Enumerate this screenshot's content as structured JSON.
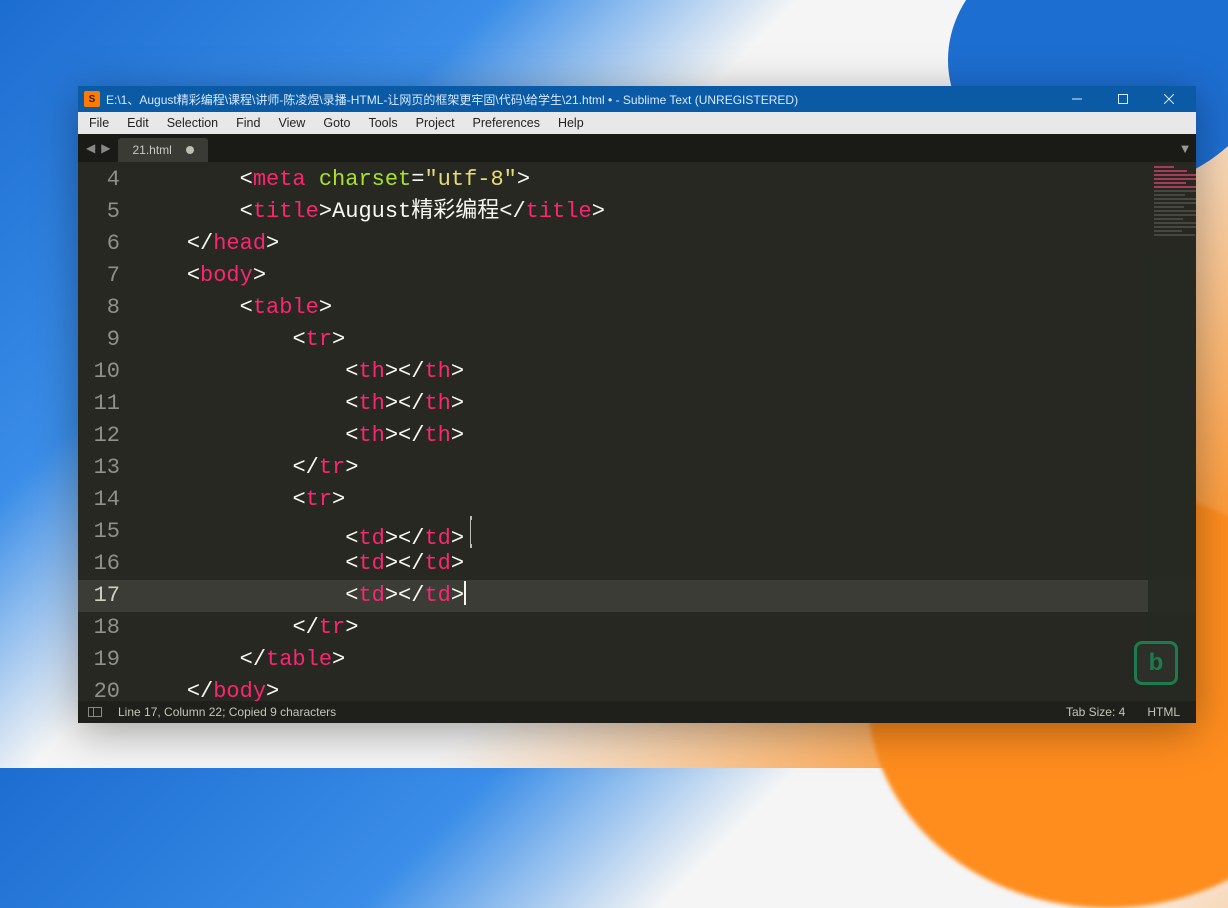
{
  "window": {
    "title": "E:\\1、August精彩编程\\课程\\讲师-陈凌煜\\录播-HTML-让网页的框架更牢固\\代码\\给学生\\21.html • - Sublime Text (UNREGISTERED)",
    "app_icon_letter": "S"
  },
  "menubar": [
    "File",
    "Edit",
    "Selection",
    "Find",
    "View",
    "Goto",
    "Tools",
    "Project",
    "Preferences",
    "Help"
  ],
  "tab": {
    "label": "21.html"
  },
  "gutter": {
    "start": 4,
    "end": 20,
    "active": 17
  },
  "code_lines": [
    {
      "n": 4,
      "indent": 2,
      "tokens": [
        [
          "angle",
          "<"
        ],
        [
          "tagname",
          "meta"
        ],
        [
          "punct",
          " "
        ],
        [
          "attr",
          "charset"
        ],
        [
          "punct",
          "="
        ],
        [
          "string",
          "\"utf-8\""
        ],
        [
          "angle",
          ">"
        ]
      ]
    },
    {
      "n": 5,
      "indent": 2,
      "tokens": [
        [
          "angle",
          "<"
        ],
        [
          "tagname",
          "title"
        ],
        [
          "angle",
          ">"
        ],
        [
          "text",
          "August精彩编程"
        ],
        [
          "angle",
          "</"
        ],
        [
          "tagname",
          "title"
        ],
        [
          "angle",
          ">"
        ]
      ]
    },
    {
      "n": 6,
      "indent": 1,
      "tokens": [
        [
          "angle",
          "</"
        ],
        [
          "tagname",
          "head"
        ],
        [
          "angle",
          ">"
        ]
      ]
    },
    {
      "n": 7,
      "indent": 1,
      "tokens": [
        [
          "angle",
          "<"
        ],
        [
          "tagname",
          "body"
        ],
        [
          "angle",
          ">"
        ]
      ]
    },
    {
      "n": 8,
      "indent": 2,
      "tokens": [
        [
          "angle",
          "<"
        ],
        [
          "tagname",
          "table"
        ],
        [
          "angle",
          ">"
        ]
      ]
    },
    {
      "n": 9,
      "indent": 3,
      "tokens": [
        [
          "angle",
          "<"
        ],
        [
          "tagname",
          "tr"
        ],
        [
          "angle",
          ">"
        ]
      ]
    },
    {
      "n": 10,
      "indent": 4,
      "tokens": [
        [
          "angle",
          "<"
        ],
        [
          "tagname",
          "th"
        ],
        [
          "angle",
          ">"
        ],
        [
          "angle",
          "</"
        ],
        [
          "tagname",
          "th"
        ],
        [
          "angle",
          ">"
        ]
      ]
    },
    {
      "n": 11,
      "indent": 4,
      "tokens": [
        [
          "angle",
          "<"
        ],
        [
          "tagname",
          "th"
        ],
        [
          "angle",
          ">"
        ],
        [
          "angle",
          "</"
        ],
        [
          "tagname",
          "th"
        ],
        [
          "angle",
          ">"
        ]
      ]
    },
    {
      "n": 12,
      "indent": 4,
      "tokens": [
        [
          "angle",
          "<"
        ],
        [
          "tagname",
          "th"
        ],
        [
          "angle",
          ">"
        ],
        [
          "angle",
          "</"
        ],
        [
          "tagname",
          "th"
        ],
        [
          "angle",
          ">"
        ]
      ]
    },
    {
      "n": 13,
      "indent": 3,
      "tokens": [
        [
          "angle",
          "</"
        ],
        [
          "tagname",
          "tr"
        ],
        [
          "angle",
          ">"
        ]
      ]
    },
    {
      "n": 14,
      "indent": 3,
      "tokens": [
        [
          "angle",
          "<"
        ],
        [
          "tagname",
          "tr"
        ],
        [
          "angle",
          ">"
        ]
      ]
    },
    {
      "n": 15,
      "indent": 4,
      "tokens": [
        [
          "angle",
          "<"
        ],
        [
          "tagname",
          "td"
        ],
        [
          "angle",
          ">"
        ],
        [
          "angle",
          "</"
        ],
        [
          "tagname",
          "td"
        ],
        [
          "angle",
          ">"
        ]
      ],
      "ibeam_after": true
    },
    {
      "n": 16,
      "indent": 4,
      "tokens": [
        [
          "angle",
          "<"
        ],
        [
          "tagname",
          "td"
        ],
        [
          "angle",
          ">"
        ],
        [
          "angle",
          "</"
        ],
        [
          "tagname",
          "td"
        ],
        [
          "angle",
          ">"
        ]
      ]
    },
    {
      "n": 17,
      "indent": 4,
      "tokens": [
        [
          "angle",
          "<"
        ],
        [
          "tagname",
          "td"
        ],
        [
          "angle",
          ">"
        ],
        [
          "angle",
          "</"
        ],
        [
          "tagname",
          "td"
        ],
        [
          "angle",
          ">"
        ]
      ],
      "cursor_after": true
    },
    {
      "n": 18,
      "indent": 3,
      "tokens": [
        [
          "angle",
          "</"
        ],
        [
          "tagname",
          "tr"
        ],
        [
          "angle",
          ">"
        ]
      ]
    },
    {
      "n": 19,
      "indent": 2,
      "tokens": [
        [
          "angle",
          "</"
        ],
        [
          "tagname",
          "table"
        ],
        [
          "angle",
          ">"
        ]
      ]
    },
    {
      "n": 20,
      "indent": 1,
      "tokens": [
        [
          "angle",
          "</"
        ],
        [
          "tagname",
          "body"
        ],
        [
          "angle",
          ">"
        ]
      ]
    }
  ],
  "statusbar": {
    "position": "Line 17, Column 22; Copied 9 characters",
    "tab_size": "Tab Size: 4",
    "syntax": "HTML"
  },
  "watermark": {
    "logo_letter": "b",
    "text": ""
  }
}
